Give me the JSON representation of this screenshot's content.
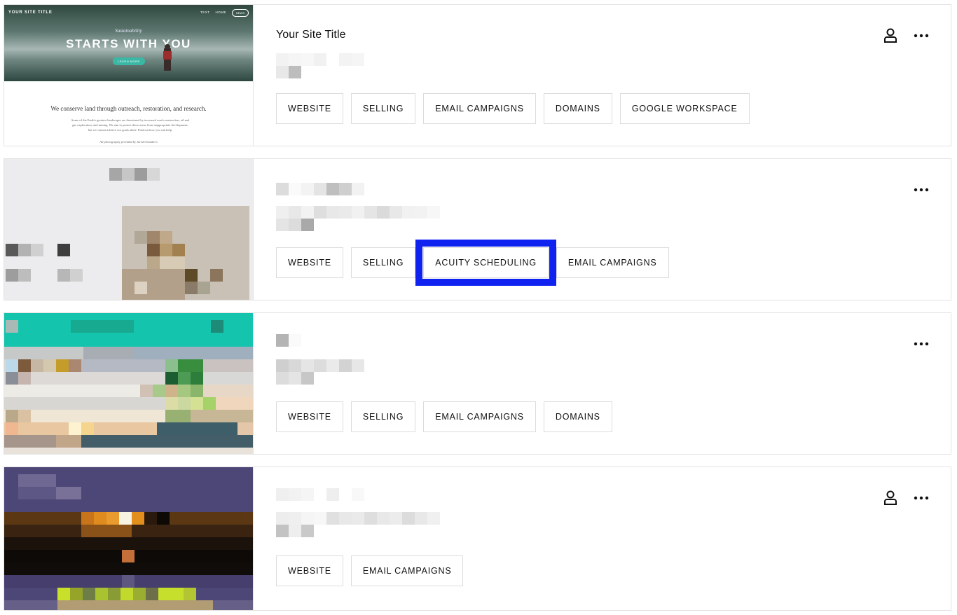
{
  "sites": [
    {
      "title": "Your Site Title",
      "thumbnail": {
        "nav_title": "YOUR SITE TITLE",
        "nav_links": [
          "TEXT",
          "HOME"
        ],
        "nav_button": "NEWS",
        "kicker": "Sustainability",
        "headline": "STARTS WITH YOU",
        "cta": "LEARN MORE",
        "tagline": "We conserve land through outreach, restoration, and research.",
        "paragraph": "Some of the Earth's greatest landscapes are threatened by increased road construction, oil and gas exploration, and mining. We aim to protect these areas from inappropriate development, but we cannot achieve our goals alone. Find out how you can help.",
        "credit": "All photography provided by Jared Chambers"
      },
      "show_owner_icon": true,
      "products": [
        "WEBSITE",
        "SELLING",
        "EMAIL CAMPAIGNS",
        "DOMAINS",
        "GOOGLE WORKSPACE"
      ]
    },
    {
      "title": "",
      "show_owner_icon": false,
      "products": [
        "WEBSITE",
        "SELLING",
        "ACUITY SCHEDULING",
        "EMAIL CAMPAIGNS"
      ],
      "highlighted_product": "ACUITY SCHEDULING"
    },
    {
      "title": "",
      "show_owner_icon": false,
      "products": [
        "WEBSITE",
        "SELLING",
        "EMAIL CAMPAIGNS",
        "DOMAINS"
      ]
    },
    {
      "title": "",
      "show_owner_icon": true,
      "products": [
        "WEBSITE",
        "EMAIL CAMPAIGNS"
      ]
    }
  ],
  "icons": {
    "owner": "person-icon",
    "more": "more-options-icon"
  },
  "colors": {
    "highlight": "#1022f0",
    "border": "#e3e3e3",
    "text": "#111111"
  }
}
